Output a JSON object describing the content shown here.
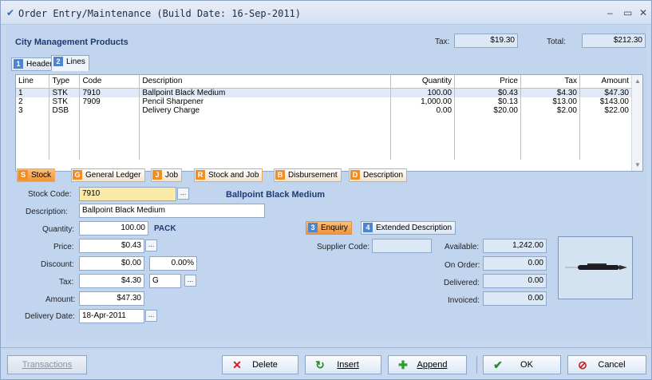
{
  "title": "Order Entry/Maintenance (Build Date: 16-Sep-2011)",
  "company": "City Management Products",
  "totals": {
    "tax_label": "Tax:",
    "tax": "$19.30",
    "total_label": "Total:",
    "total": "$212.30"
  },
  "tabs": [
    {
      "num": "1",
      "label": "Header"
    },
    {
      "num": "2",
      "label": "Lines"
    }
  ],
  "grid": {
    "columns": [
      "Line",
      "Type",
      "Code",
      "Description",
      "Quantity",
      "Price",
      "Tax",
      "Amount"
    ],
    "rows": [
      [
        "1",
        "STK",
        "7910",
        "Ballpoint Black Medium",
        "100.00",
        "$0.43",
        "$4.30",
        "$47.30"
      ],
      [
        "2",
        "STK",
        "7909",
        "Pencil Sharpener",
        "1,000.00",
        "$0.13",
        "$13.00",
        "$143.00"
      ],
      [
        "3",
        "DSB",
        "",
        "Delivery Charge",
        "0.00",
        "$20.00",
        "$2.00",
        "$22.00"
      ]
    ]
  },
  "line_types": [
    {
      "key": "S",
      "label": "Stock"
    },
    {
      "key": "G",
      "label": "General Ledger"
    },
    {
      "key": "J",
      "label": "Job"
    },
    {
      "key": "R",
      "label": "Stock and Job"
    },
    {
      "key": "B",
      "label": "Disbursement"
    },
    {
      "key": "D",
      "label": "Description"
    }
  ],
  "detail": {
    "stock_code_label": "Stock Code:",
    "stock_code": "7910",
    "stock_name": "Ballpoint Black Medium",
    "description_label": "Description:",
    "description": "Ballpoint Black Medium",
    "quantity_label": "Quantity:",
    "quantity": "100.00",
    "unit": "PACK",
    "price_label": "Price:",
    "price": "$0.43",
    "discount_label": "Discount:",
    "discount": "$0.00",
    "discount_pct": "0.00%",
    "tax_label": "Tax:",
    "tax": "$4.30",
    "tax_code": "G",
    "amount_label": "Amount:",
    "amount": "$47.30",
    "delivery_label": "Delivery Date:",
    "delivery_date": "18-Apr-2011"
  },
  "sub_tabs": [
    {
      "num": "3",
      "label": "Enquiry"
    },
    {
      "num": "4",
      "label": "Extended Description"
    }
  ],
  "enquiry": {
    "supplier_label": "Supplier Code:",
    "supplier": "",
    "available_label": "Available:",
    "available": "1,242.00",
    "on_order_label": "On Order:",
    "on_order": "0.00",
    "delivered_label": "Delivered:",
    "delivered": "0.00",
    "invoiced_label": "Invoiced:",
    "invoiced": "0.00"
  },
  "buttons": {
    "transactions": "Transactions",
    "delete": "Delete",
    "insert": "Insert",
    "append": "Append",
    "ok": "OK",
    "cancel": "Cancel"
  },
  "colors": {
    "accent_orange": "#f08d25",
    "tab_blue": "#4d86cf",
    "company_blue": "#1f3a72"
  }
}
